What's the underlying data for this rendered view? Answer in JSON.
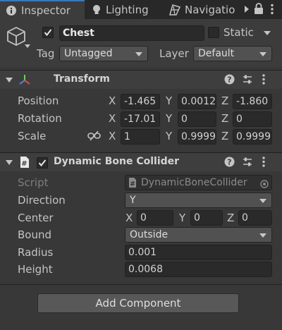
{
  "tabs": [
    {
      "label": "Inspector",
      "icon": "info-icon",
      "active": true
    },
    {
      "label": "Lighting",
      "icon": "lightbulb-icon",
      "active": false
    },
    {
      "label": "Navigatio",
      "icon": "navigation-icon",
      "active": false
    }
  ],
  "gameobject": {
    "name": "Chest",
    "active": true,
    "static_label": "Static",
    "tag_label": "Tag",
    "tag_value": "Untagged",
    "layer_label": "Layer",
    "layer_value": "Default"
  },
  "transform": {
    "title": "Transform",
    "position": {
      "label": "Position",
      "x": "-1.465",
      "y": "0.0012",
      "z": "-1.860"
    },
    "rotation": {
      "label": "Rotation",
      "x": "-17.01",
      "y": "0",
      "z": "0"
    },
    "scale": {
      "label": "Scale",
      "x": "1",
      "y": "0.9999",
      "z": "0.9999"
    }
  },
  "collider": {
    "title": "Dynamic Bone Collider",
    "script_label": "Script",
    "script_value": "DynamicBoneCollider",
    "direction_label": "Direction",
    "direction_value": "Y",
    "center_label": "Center",
    "center": {
      "x": "0",
      "y": "0",
      "z": "0"
    },
    "bound_label": "Bound",
    "bound_value": "Outside",
    "radius_label": "Radius",
    "radius_value": "0.001",
    "height_label": "Height",
    "height_value": "0.0068"
  },
  "axes": {
    "x": "X",
    "y": "Y",
    "z": "Z"
  },
  "add_component_label": "Add Component",
  "colors": {
    "accent": "#3a79bb",
    "background": "#383838",
    "field": "#2a2a2a"
  }
}
